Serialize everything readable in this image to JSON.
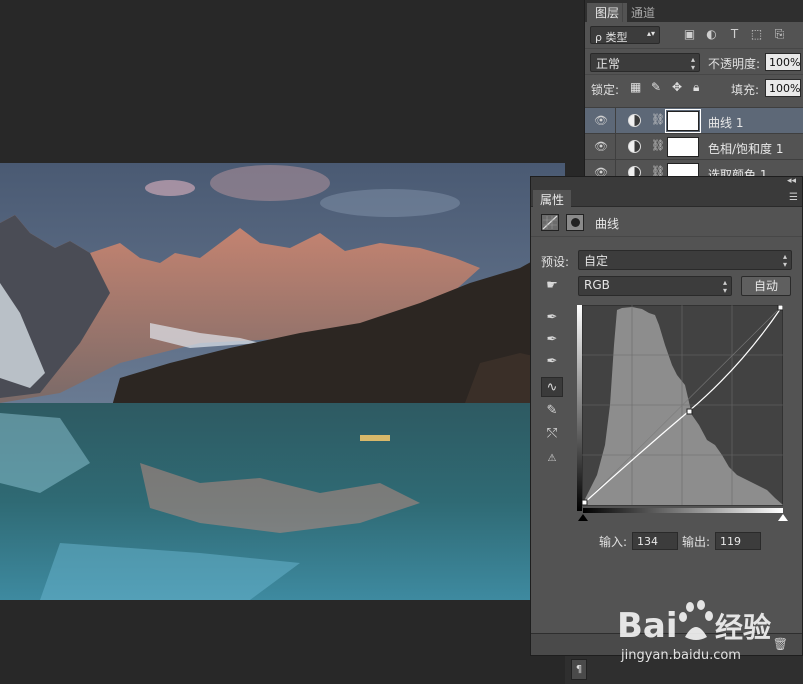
{
  "layers_panel": {
    "tabs": [
      "图层",
      "通道"
    ],
    "filter": {
      "label": "ρ 类型",
      "icons": [
        "image-filter-icon",
        "adjustment-filter-icon",
        "type-filter-icon",
        "shape-filter-icon",
        "smart-object-filter-icon"
      ]
    },
    "blend_mode": "正常",
    "opacity_label": "不透明度:",
    "opacity_value": "100%",
    "lock_label": "锁定:",
    "fill_label": "填充:",
    "fill_value": "100%",
    "layers": [
      {
        "name": "曲线 1",
        "selected": true
      },
      {
        "name": "色相/饱和度 1",
        "selected": false
      },
      {
        "name": "选取颜色 1",
        "selected": false
      }
    ]
  },
  "properties_panel": {
    "tab": "属性",
    "title": "曲线",
    "preset_label": "预设:",
    "preset_value": "自定",
    "channel_value": "RGB",
    "auto_button": "自动",
    "input_label": "输入:",
    "input_value": "134",
    "output_label": "输出:",
    "output_value": "119",
    "curve_point": {
      "input": 134,
      "output": 119
    }
  },
  "watermark": {
    "logo_text": "Bai 经验",
    "url": "jingyan.baidu.com"
  }
}
